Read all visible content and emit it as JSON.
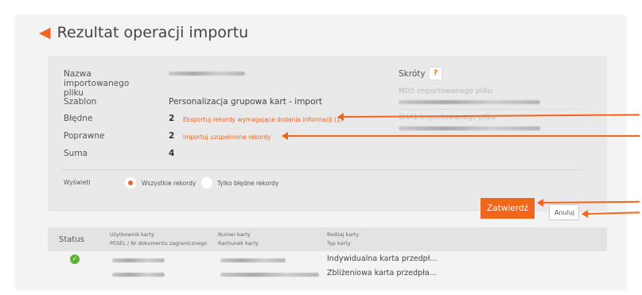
{
  "page": {
    "title": "Rezultat operacji importu"
  },
  "summary": {
    "file_name_label": "Nazwa importowanego pliku",
    "template_label": "Szablon",
    "template_value": "Personalizacja grupowa kart - import",
    "errors_label": "Błędne",
    "errors_count": "2",
    "errors_link": "Eksportuj rekordy wymagające dodania informacji (1)",
    "valid_label": "Poprawne",
    "valid_count": "2",
    "valid_link": "Importuj uzupełnione rekordy",
    "sum_label": "Suma",
    "sum_value": "4"
  },
  "shortcuts": {
    "label": "Skróty",
    "help": "?",
    "md5_label": "MD5 importowanego pliku",
    "sha_label": "SHA1 importowanego pliku"
  },
  "filter": {
    "label": "Wyświetl",
    "option_all": "Wszystkie rekordy",
    "option_errors": "Tylko błędne rekordy"
  },
  "buttons": {
    "confirm": "Zatwierdź",
    "cancel": "Anuluj"
  },
  "table": {
    "headers": {
      "status": "Status",
      "user_line1": "Użytkownik karty",
      "user_line2": "PESEL / Nr dokumentu zagranicznego",
      "card_line1": "Numer karty",
      "card_line2": "Rachunek karty",
      "type_line1": "Rodzaj karty",
      "type_line2": "Typ karty"
    },
    "rows": [
      {
        "type_line1": "Indywidualna karta przedpł...",
        "type_line2": "Zbliżeniowa karta przedpła..."
      }
    ]
  },
  "colors": {
    "accent": "#f2651d",
    "success": "#5fb236"
  }
}
